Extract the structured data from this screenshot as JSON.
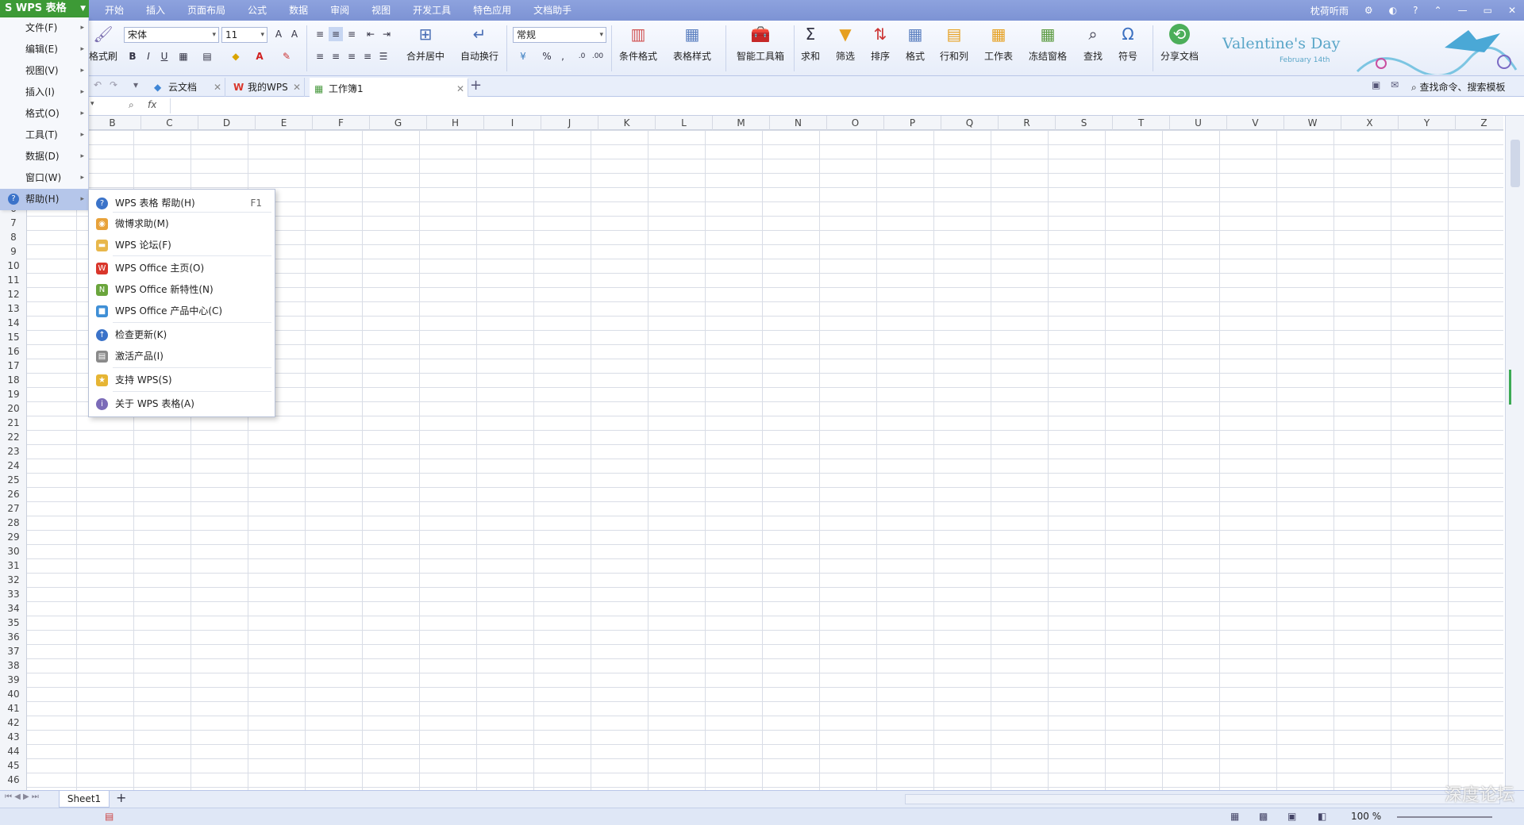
{
  "app": {
    "name": "WPS 表格",
    "user": "枕荷听雨"
  },
  "menu_tabs": [
    "开始",
    "插入",
    "页面布局",
    "公式",
    "数据",
    "审阅",
    "视图",
    "开发工具",
    "特色应用",
    "文档助手"
  ],
  "left_menu": [
    {
      "label": "文件(F)"
    },
    {
      "label": "编辑(E)"
    },
    {
      "label": "视图(V)"
    },
    {
      "label": "插入(I)"
    },
    {
      "label": "格式(O)"
    },
    {
      "label": "工具(T)"
    },
    {
      "label": "数据(D)"
    },
    {
      "label": "窗口(W)"
    },
    {
      "label": "帮助(H)"
    }
  ],
  "help_menu": [
    {
      "label": "WPS 表格 帮助(H)",
      "key": "F1",
      "icon": "help-icon",
      "color": "#3b73c9"
    },
    {
      "label": "微博求助(M)",
      "key": "",
      "icon": "weibo-icon",
      "color": "#e8a23a"
    },
    {
      "label": "WPS 论坛(F)",
      "key": "",
      "icon": "forum-icon",
      "color": "#e8b74b"
    },
    {
      "label": "WPS Office 主页(O)",
      "key": "",
      "icon": "wps-logo-icon",
      "color": "#d9362b"
    },
    {
      "label": "WPS Office 新特性(N)",
      "key": "",
      "icon": "new-features-icon",
      "color": "#6aa53c"
    },
    {
      "label": "WPS Office 产品中心(C)",
      "key": "",
      "icon": "product-center-icon",
      "color": "#3f8fd6"
    },
    {
      "label": "检查更新(K)",
      "key": "",
      "icon": "update-icon",
      "color": "#3b73c9"
    },
    {
      "label": "激活产品(I)",
      "key": "",
      "icon": "activate-icon",
      "color": "#8a8a8a"
    },
    {
      "label": "支持 WPS(S)",
      "key": "",
      "icon": "support-icon",
      "color": "#e6b534"
    },
    {
      "label": "关于 WPS 表格(A)",
      "key": "",
      "icon": "about-icon",
      "color": "#7b6bb8"
    }
  ],
  "ribbon": {
    "format_painter": "格式刷",
    "font": "宋体",
    "size": "11",
    "number_format": "常规",
    "merge": "合并居中",
    "wrap": "自动换行",
    "cond_format": "条件格式",
    "table_style": "表格样式",
    "smart_toolbox": "智能工具箱",
    "sum": "求和",
    "filter": "筛选",
    "sort": "排序",
    "format": "格式",
    "rowcol": "行和列",
    "worksheet": "工作表",
    "freeze": "冻结窗格",
    "find": "查找",
    "symbol": "符号",
    "share": "分享文档"
  },
  "banner": {
    "title": "Valentine's Day",
    "subtitle": "February 14th"
  },
  "doc_tabs": [
    {
      "label": "云文档",
      "icon": "cloud-icon"
    },
    {
      "label": "我的WPS",
      "icon": "wps-logo-icon"
    },
    {
      "label": "工作簿1",
      "icon": "workbook-icon"
    }
  ],
  "search_label": "查找命令、搜索模板",
  "formula_fx": "fx",
  "columns": [
    "B",
    "C",
    "D",
    "E",
    "F",
    "G",
    "H",
    "I",
    "J",
    "K",
    "L",
    "M",
    "N",
    "O",
    "P",
    "Q",
    "R",
    "S",
    "T",
    "U",
    "V",
    "W",
    "X",
    "Y",
    "Z"
  ],
  "rows": [
    "6",
    "7",
    "8",
    "9",
    "10",
    "11",
    "12",
    "13",
    "14",
    "15",
    "16",
    "17",
    "18",
    "19",
    "20",
    "21",
    "22",
    "23",
    "24",
    "25",
    "26",
    "27",
    "28",
    "29",
    "30",
    "31",
    "32",
    "33",
    "34",
    "35",
    "36",
    "37",
    "38",
    "39",
    "40",
    "41",
    "42",
    "43",
    "44",
    "45",
    "46"
  ],
  "sheet_tab": "Sheet1",
  "zoom": "100 %",
  "watermark": "深度论坛"
}
